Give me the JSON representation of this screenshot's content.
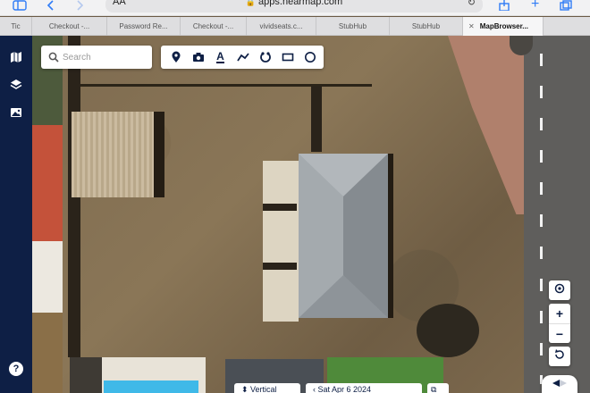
{
  "browser": {
    "url": "apps.nearmap.com",
    "reader_label": "AA",
    "tabs": [
      {
        "label": "Tic",
        "width": 36
      },
      {
        "label": "Checkout -...",
        "width": 84
      },
      {
        "label": "Password Re...",
        "width": 82
      },
      {
        "label": "Checkout -...",
        "width": 74
      },
      {
        "label": "vividseats.c...",
        "width": 78
      },
      {
        "label": "StubHub",
        "width": 82
      },
      {
        "label": "StubHub",
        "width": 82
      },
      {
        "label": "MapBrowser...",
        "width": 90,
        "active": true,
        "close": "✕"
      }
    ]
  },
  "search": {
    "placeholder": "Search",
    "value": ""
  },
  "toolbar": {
    "tools": [
      "marker-icon",
      "camera-icon",
      "text-icon",
      "polyline-icon",
      "radius-icon",
      "rectangle-icon",
      "circle-icon"
    ],
    "text_tool_label": "A"
  },
  "sidebar": {
    "items": [
      "map-icon",
      "layers-icon",
      "image-icon"
    ],
    "help_label": "?"
  },
  "map_controls": {
    "zoom_in": "+",
    "zoom_out": "−"
  },
  "bottom": {
    "vertical_label": "Vertical",
    "date_label": "Sat Apr 6 2024"
  },
  "colors": {
    "sidebar": "#0e1f45",
    "accent": "#2f7cf6"
  }
}
